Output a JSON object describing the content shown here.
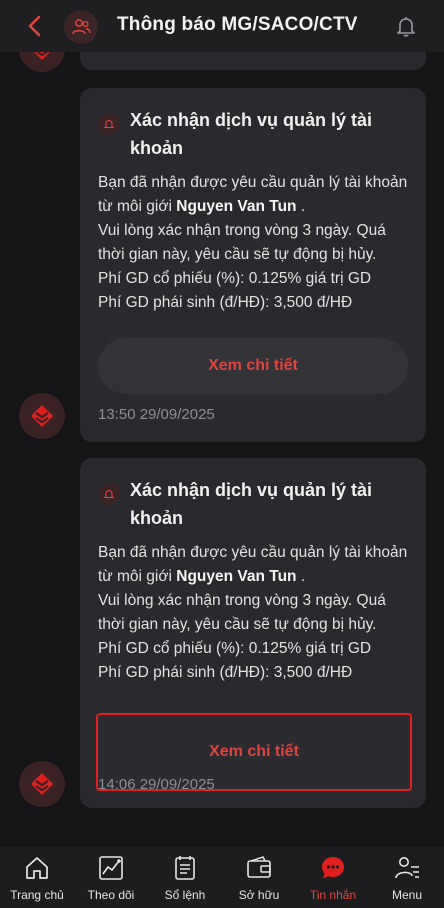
{
  "header": {
    "title": "Thông báo MG/SACO/CTV"
  },
  "notifications": [
    {
      "title": "Xác nhận dịch vụ quản lý tài khoản",
      "body_line1": "Bạn đã nhận được yêu cầu quản lý tài khoản từ môi giới ",
      "broker_name": "Nguyen Van Tun",
      "body_line1_end": " .",
      "body_line2": "Vui lòng xác nhận trong vòng 3 ngày. Quá thời gian này, yêu cầu sẽ tự động bị hủy.",
      "body_line3": "Phí GD cổ phiếu (%): 0.125% giá trị GD",
      "body_line4": "Phí GD phái sinh (đ/HĐ): 3,500 đ/HĐ",
      "button_label": "Xem chi tiết",
      "timestamp": "13:50 29/09/2025"
    },
    {
      "title": "Xác nhận dịch vụ quản lý tài khoản",
      "body_line1": "Bạn đã nhận được yêu cầu quản lý tài khoản từ môi giới ",
      "broker_name": "Nguyen Van Tun",
      "body_line1_end": " .",
      "body_line2": "Vui lòng xác nhận trong vòng 3 ngày. Quá thời gian này, yêu cầu sẽ tự động bị hủy.",
      "body_line3": "Phí GD cổ phiếu (%): 0.125% giá trị GD",
      "body_line4": "Phí GD phái sinh (đ/HĐ): 3,500 đ/HĐ",
      "button_label": "Xem chi tiết",
      "timestamp": "14:06 29/09/2025"
    }
  ],
  "bottom_nav": [
    {
      "label": "Trang chủ",
      "icon": "home-icon"
    },
    {
      "label": "Theo dõi",
      "icon": "chart-icon"
    },
    {
      "label": "Sổ lệnh",
      "icon": "orderbook-icon"
    },
    {
      "label": "Sở hữu",
      "icon": "wallet-icon"
    },
    {
      "label": "Tin nhắn",
      "icon": "chat-icon",
      "active": true
    },
    {
      "label": "Menu",
      "icon": "menu-user-icon"
    }
  ],
  "colors": {
    "accent": "#e0443e",
    "background": "#151517",
    "card": "#2a2a2e",
    "highlight_border": "#e0201e"
  }
}
